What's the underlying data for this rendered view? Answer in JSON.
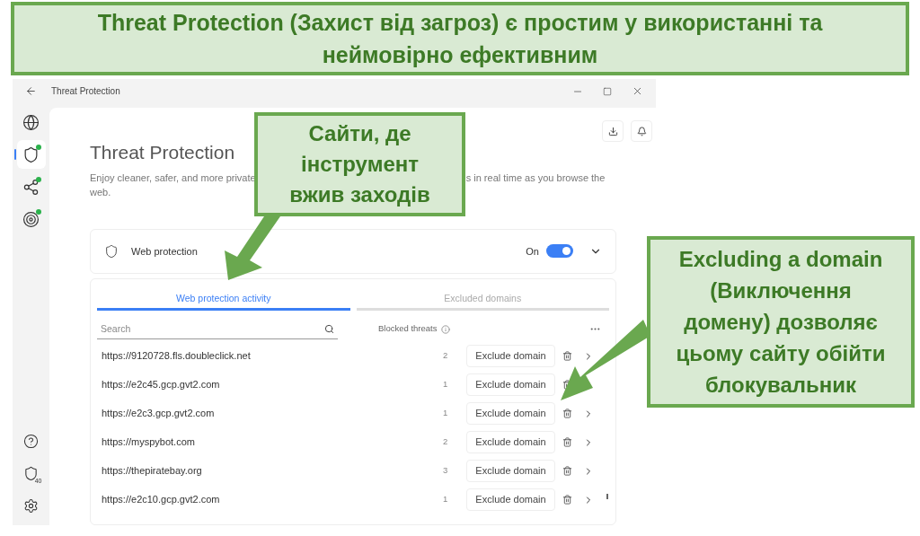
{
  "banner": {
    "text": "Threat Protection (Захист від загроз) є простим у використанні та неймовірно ефективним"
  },
  "window": {
    "title": "Threat Protection"
  },
  "sidebar": {
    "items": [
      {
        "kind": "globe",
        "selected": false,
        "badge": false
      },
      {
        "kind": "shield",
        "selected": true,
        "badge": true
      },
      {
        "kind": "nodes",
        "selected": false,
        "badge": true
      },
      {
        "kind": "target",
        "selected": false,
        "badge": true
      }
    ],
    "bottom_items": [
      {
        "kind": "help"
      },
      {
        "kind": "shield-count",
        "count": "40"
      },
      {
        "kind": "settings"
      }
    ]
  },
  "header": {
    "title": "Threat Protection",
    "description_parts": [
      "Enjoy cleaner, safer, and more private",
      "s in real time as you browse the",
      "web."
    ]
  },
  "web_protection": {
    "label": "Web protection",
    "toggle_label": "On",
    "on": true,
    "expanded": false
  },
  "tabs": [
    {
      "label": "Web protection activity",
      "selected": true
    },
    {
      "label": "Excluded domains",
      "selected": false
    }
  ],
  "search": {
    "placeholder": "Search"
  },
  "column_header": "Blocked threats",
  "rows": [
    {
      "url": "https://9120728.fls.doubleclick.net",
      "count": "2",
      "button": "Exclude domain"
    },
    {
      "url": "https://e2c45.gcp.gvt2.com",
      "count": "1",
      "button": "Exclude domain"
    },
    {
      "url": "https://e2c3.gcp.gvt2.com",
      "count": "1",
      "button": "Exclude domain"
    },
    {
      "url": "https://myspybot.com",
      "count": "2",
      "button": "Exclude domain"
    },
    {
      "url": "https://thepiratebay.org",
      "count": "3",
      "button": "Exclude domain"
    },
    {
      "url": "https://e2c10.gcp.gvt2.com",
      "count": "1",
      "button": "Exclude domain"
    }
  ],
  "callouts": [
    {
      "text": "Сайти, де інструмент вжив заходів"
    },
    {
      "text": "Excluding a domain (Виключення домену) дозволяє цьому сайту обійти блокувальник"
    }
  ]
}
